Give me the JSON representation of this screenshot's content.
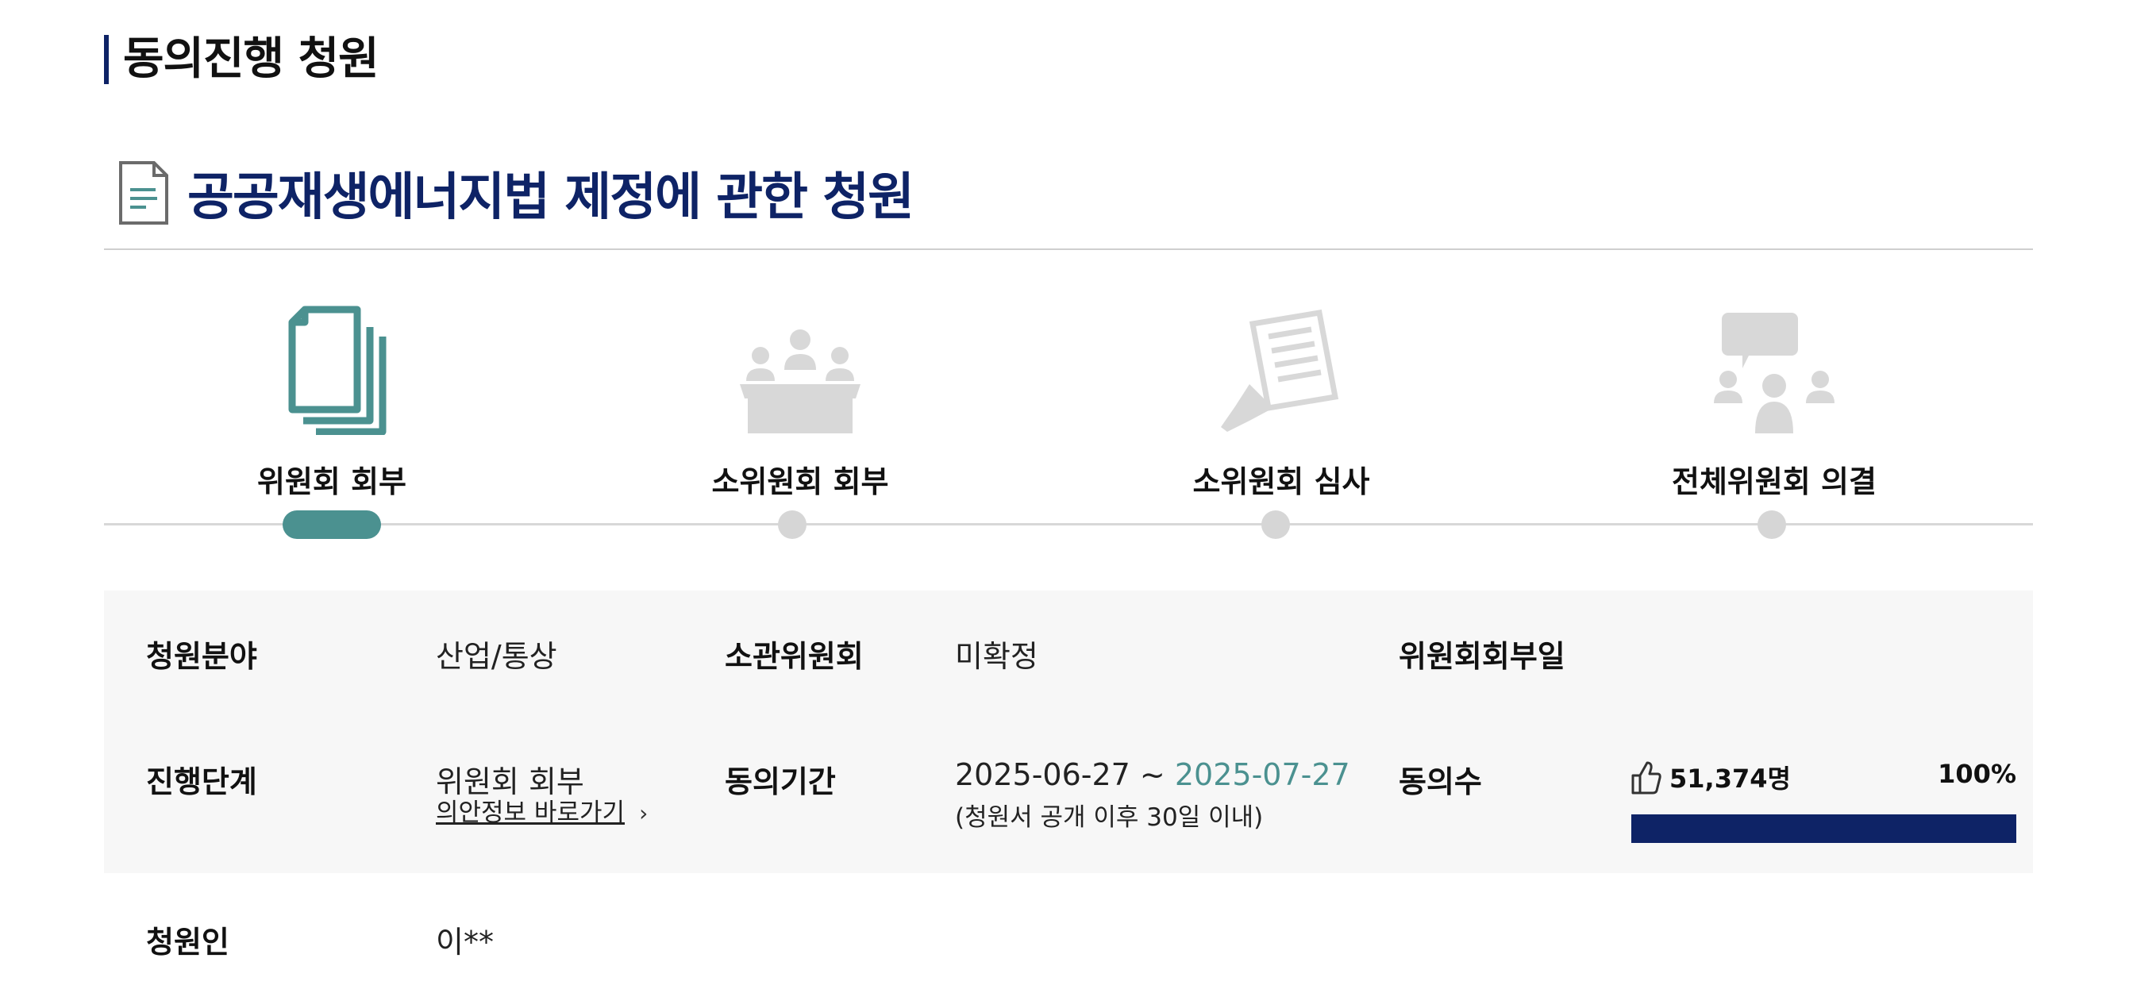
{
  "section_heading": "동의진행 청원",
  "petition": {
    "title": "공공재생에너지법 제정에 관한 청원",
    "icon": "document-icon"
  },
  "steps": [
    {
      "label": "위원회 회부",
      "icon": "documents-stack-icon",
      "active": true
    },
    {
      "label": "소위원회 회부",
      "icon": "meeting-table-icon",
      "active": false
    },
    {
      "label": "소위원회 심사",
      "icon": "review-document-icon",
      "active": false
    },
    {
      "label": "전체위원회 의결",
      "icon": "discussion-icon",
      "active": false
    }
  ],
  "info": {
    "field_label": "청원분야",
    "field_value": "산업/통상",
    "committee_label": "소관위원회",
    "committee_value": "미확정",
    "referral_date_label": "위원회회부일",
    "referral_date_value": "",
    "stage_label": "진행단계",
    "stage_value": "위원회 회부",
    "bill_link": "의안정보 바로가기",
    "period_label": "동의기간",
    "period_start": "2025-06-27 ~",
    "period_end": "2025-07-27",
    "period_note": "(청원서 공개 이후 30일 이내)",
    "agree_label": "동의수",
    "agree_count": "51,374명",
    "agree_percent": "100%",
    "agree_progress": 1.0,
    "petitioner_label": "청원인",
    "petitioner_value": "이**"
  },
  "colors": {
    "navy": "#0e2366",
    "teal": "#4b9190",
    "inactive": "#d6d6d6"
  }
}
